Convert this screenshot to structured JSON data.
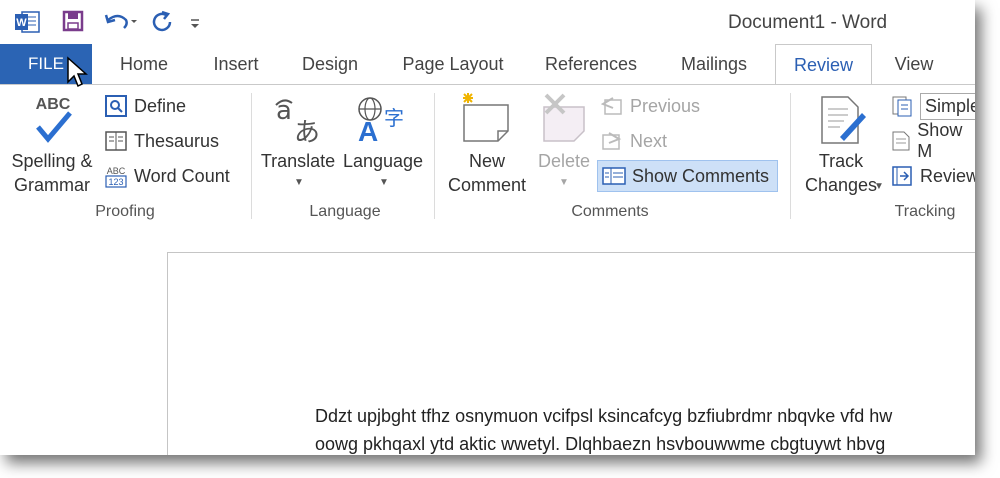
{
  "window": {
    "title": "Document1 - Word"
  },
  "qat": {
    "app_icon": "word-icon",
    "save_icon": "save-icon",
    "undo_icon": "undo-icon",
    "redo_icon": "redo-icon",
    "customize_icon": "customize-icon"
  },
  "tabs": [
    {
      "label": "FILE"
    },
    {
      "label": "Home"
    },
    {
      "label": "Insert"
    },
    {
      "label": "Design"
    },
    {
      "label": "Page Layout"
    },
    {
      "label": "References"
    },
    {
      "label": "Mailings"
    },
    {
      "label": "Review"
    },
    {
      "label": "View"
    }
  ],
  "ribbon": {
    "proofing": {
      "spelling_line1": "Spelling &",
      "spelling_line2": "Grammar",
      "define": "Define",
      "thesaurus": "Thesaurus",
      "word_count": "Word Count",
      "group_label": "Proofing"
    },
    "language": {
      "translate": "Translate",
      "language": "Language",
      "group_label": "Language"
    },
    "comments": {
      "new_line1": "New",
      "new_line2": "Comment",
      "delete": "Delete",
      "previous": "Previous",
      "next": "Next",
      "show_comments": "Show Comments",
      "group_label": "Comments"
    },
    "tracking": {
      "track_line1": "Track",
      "track_line2": "Changes",
      "simple": "Simple",
      "show_markup": "Show M",
      "reviewing": "Review",
      "group_label": "Tracking"
    }
  },
  "document": {
    "line1": "Ddzt upjbght tfhz osnymuon vcifpsl ksincafcyg bzfiubrdmr nbqvke vfd hw",
    "line2": "oowg pkhqaxl ytd aktic wwetyl. Dlqhbaezn hsvbouwwme cbgtuywt hbvg"
  }
}
